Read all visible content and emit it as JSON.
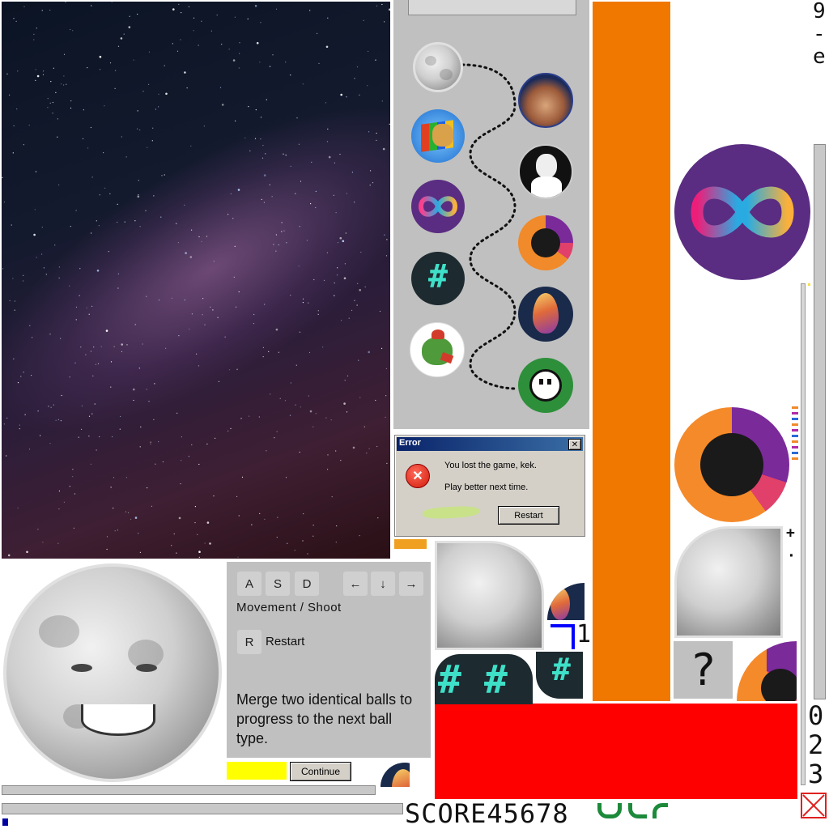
{
  "colors": {
    "orange_bar": "#f07800",
    "red_block": "#ff0000",
    "yellow_block": "#ffff00",
    "panel_gray": "#c0c0c0",
    "error_title": "#0a246a",
    "icp_purple": "#5a2d82"
  },
  "dialog": {
    "title": "Error",
    "message_line1": "You lost the game, kek.",
    "message_line2": "Play better next time.",
    "restart_label": "Restart",
    "close_symbol": "✕",
    "error_symbol": "✕"
  },
  "controls": {
    "keys_left": [
      "A",
      "S",
      "D"
    ],
    "keys_arrows": [
      "←",
      "↓",
      "→"
    ],
    "movement_label": "Movement / Shoot",
    "restart_key": "R",
    "restart_label": "Restart",
    "hint": "Merge two identical balls to progress to the next ball type.",
    "continue_label": "Continue"
  },
  "score_font": {
    "glyphs": "SCORE45678",
    "glyphs_right_top": "9-e",
    "glyphs_right_bottom": "023",
    "glyph_one": "1"
  },
  "chain_balls_left": [
    "moon-face",
    "doge-window",
    "infinity-logo",
    "hashtag-logo",
    "pepe-chicken"
  ],
  "chain_balls_right": [
    "hawking-face",
    "gentleman-meme",
    "orange-ring-logo",
    "dragon-egg",
    "ghost-pixel"
  ],
  "misc": {
    "question_mark": "?",
    "plus_mark": "+",
    "dot_mark": "·"
  },
  "sliders": {
    "vertical_right_level": 1.0,
    "horizontal_bottom_level": 1.0
  }
}
